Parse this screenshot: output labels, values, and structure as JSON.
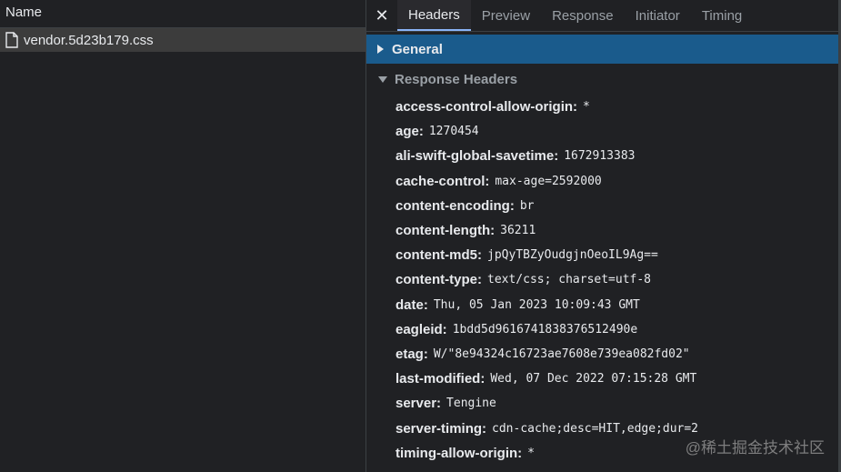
{
  "requests": {
    "column_header": "Name",
    "items": [
      {
        "name": "vendor.5d23b179.css",
        "icon": "file-icon"
      }
    ]
  },
  "details": {
    "close_label": "✕",
    "tabs": [
      {
        "label": "Headers",
        "active": true
      },
      {
        "label": "Preview",
        "active": false
      },
      {
        "label": "Response",
        "active": false
      },
      {
        "label": "Initiator",
        "active": false
      },
      {
        "label": "Timing",
        "active": false
      }
    ],
    "general_label": "General",
    "response_headers_label": "Response Headers",
    "response_headers": [
      {
        "name": "access-control-allow-origin:",
        "value": "*"
      },
      {
        "name": "age:",
        "value": "1270454"
      },
      {
        "name": "ali-swift-global-savetime:",
        "value": "1672913383"
      },
      {
        "name": "cache-control:",
        "value": "max-age=2592000"
      },
      {
        "name": "content-encoding:",
        "value": "br"
      },
      {
        "name": "content-length:",
        "value": "36211"
      },
      {
        "name": "content-md5:",
        "value": "jpQyTBZyOudgjnOeoIL9Ag=="
      },
      {
        "name": "content-type:",
        "value": "text/css; charset=utf-8"
      },
      {
        "name": "date:",
        "value": "Thu, 05 Jan 2023 10:09:43 GMT"
      },
      {
        "name": "eagleid:",
        "value": "1bdd5d9616741838376512490e"
      },
      {
        "name": "etag:",
        "value": "W/\"8e94324c16723ae7608e739ea082fd02\""
      },
      {
        "name": "last-modified:",
        "value": "Wed, 07 Dec 2022 07:15:28 GMT"
      },
      {
        "name": "server:",
        "value": "Tengine"
      },
      {
        "name": "server-timing:",
        "value": "cdn-cache;desc=HIT,edge;dur=2"
      },
      {
        "name": "timing-allow-origin:",
        "value": "*"
      }
    ]
  },
  "watermark": "@稀土掘金技术社区",
  "colors": {
    "background": "#202124",
    "selected_row": "#3c3c3c",
    "general_bar": "#1a5b8c",
    "active_tab_underline": "#8ab4f8"
  }
}
